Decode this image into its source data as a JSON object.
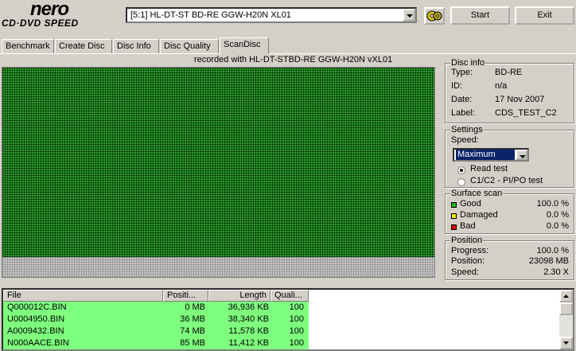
{
  "logo": {
    "top": "nero",
    "bottom": "CD·DVD SPEED"
  },
  "drive": {
    "selected": "[5:1]  HL-DT-ST BD-RE  GGW-H20N XL01"
  },
  "toolbar": {
    "start_label": "Start",
    "exit_label": "Exit"
  },
  "tabs": [
    {
      "label": "Benchmark",
      "active": false
    },
    {
      "label": "Create Disc",
      "active": false
    },
    {
      "label": "Disc Info",
      "active": false
    },
    {
      "label": "Disc Quality",
      "active": false
    },
    {
      "label": "ScanDisc",
      "active": true
    }
  ],
  "recorded_with": "recorded with HL-DT-STBD-RE  GGW-H20N  vXL01",
  "disc_info": {
    "title": "Disc info",
    "type_label": "Type:",
    "type_value": "BD-RE",
    "id_label": "ID:",
    "id_value": "n/a",
    "date_label": "Date:",
    "date_value": "17 Nov 2007",
    "label_label": "Label:",
    "label_value": "CDS_TEST_C2"
  },
  "settings": {
    "title": "Settings",
    "speed_label": "Speed:",
    "speed_value": "Maximum",
    "radio_read": "Read test",
    "radio_c1c2": "C1/C2 - PI/PO test",
    "selected_mode": "Read test"
  },
  "surface_scan": {
    "title": "Surface scan",
    "good_label": "Good",
    "good_value": "100.0 %",
    "good_color": "#22b522",
    "damaged_label": "Damaged",
    "damaged_value": "0.0 %",
    "damaged_color": "#e8e800",
    "bad_label": "Bad",
    "bad_value": "0.0 %",
    "bad_color": "#e00000"
  },
  "position": {
    "title": "Position",
    "progress_label": "Progress:",
    "progress_value": "100.0 %",
    "position_label": "Position:",
    "position_value": "23098 MB",
    "speed_label": "Speed:",
    "speed_value": "2.30 X"
  },
  "file_list": {
    "columns": [
      "File",
      "Positi...",
      "Length",
      "Quali..."
    ],
    "rows": [
      {
        "file": "Q000012C.BIN",
        "position": "0 MB",
        "length": "36,936 KB",
        "quality": "100"
      },
      {
        "file": "U0004950.BIN",
        "position": "36 MB",
        "length": "38,340 KB",
        "quality": "100"
      },
      {
        "file": "A0009432.BIN",
        "position": "74 MB",
        "length": "11,578 KB",
        "quality": "100"
      },
      {
        "file": "N000AACE.BIN",
        "position": "85 MB",
        "length": "11,412 KB",
        "quality": "100"
      }
    ]
  }
}
